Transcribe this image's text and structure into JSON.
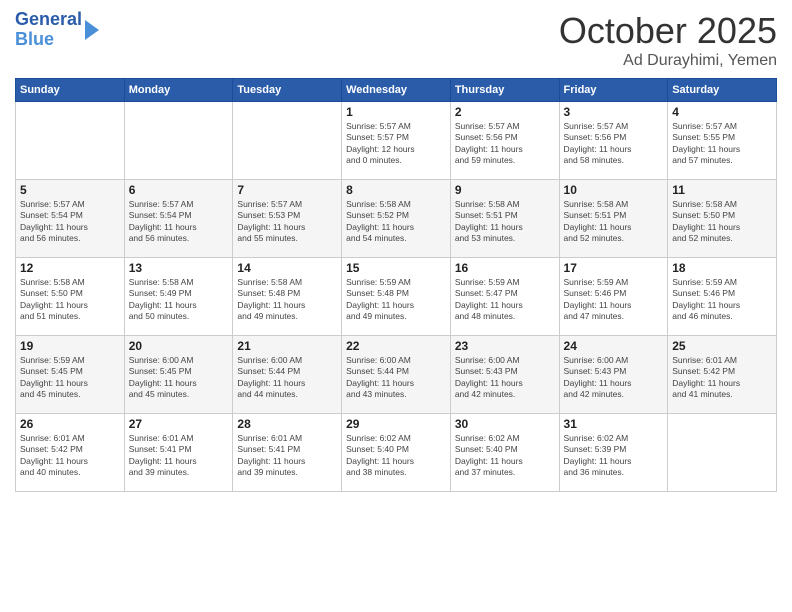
{
  "logo": {
    "line1": "General",
    "line2": "Blue"
  },
  "title": "October 2025",
  "location": "Ad Durayhimi, Yemen",
  "headers": [
    "Sunday",
    "Monday",
    "Tuesday",
    "Wednesday",
    "Thursday",
    "Friday",
    "Saturday"
  ],
  "weeks": [
    [
      {
        "day": "",
        "info": ""
      },
      {
        "day": "",
        "info": ""
      },
      {
        "day": "",
        "info": ""
      },
      {
        "day": "1",
        "info": "Sunrise: 5:57 AM\nSunset: 5:57 PM\nDaylight: 12 hours\nand 0 minutes."
      },
      {
        "day": "2",
        "info": "Sunrise: 5:57 AM\nSunset: 5:56 PM\nDaylight: 11 hours\nand 59 minutes."
      },
      {
        "day": "3",
        "info": "Sunrise: 5:57 AM\nSunset: 5:56 PM\nDaylight: 11 hours\nand 58 minutes."
      },
      {
        "day": "4",
        "info": "Sunrise: 5:57 AM\nSunset: 5:55 PM\nDaylight: 11 hours\nand 57 minutes."
      }
    ],
    [
      {
        "day": "5",
        "info": "Sunrise: 5:57 AM\nSunset: 5:54 PM\nDaylight: 11 hours\nand 56 minutes."
      },
      {
        "day": "6",
        "info": "Sunrise: 5:57 AM\nSunset: 5:54 PM\nDaylight: 11 hours\nand 56 minutes."
      },
      {
        "day": "7",
        "info": "Sunrise: 5:57 AM\nSunset: 5:53 PM\nDaylight: 11 hours\nand 55 minutes."
      },
      {
        "day": "8",
        "info": "Sunrise: 5:58 AM\nSunset: 5:52 PM\nDaylight: 11 hours\nand 54 minutes."
      },
      {
        "day": "9",
        "info": "Sunrise: 5:58 AM\nSunset: 5:51 PM\nDaylight: 11 hours\nand 53 minutes."
      },
      {
        "day": "10",
        "info": "Sunrise: 5:58 AM\nSunset: 5:51 PM\nDaylight: 11 hours\nand 52 minutes."
      },
      {
        "day": "11",
        "info": "Sunrise: 5:58 AM\nSunset: 5:50 PM\nDaylight: 11 hours\nand 52 minutes."
      }
    ],
    [
      {
        "day": "12",
        "info": "Sunrise: 5:58 AM\nSunset: 5:50 PM\nDaylight: 11 hours\nand 51 minutes."
      },
      {
        "day": "13",
        "info": "Sunrise: 5:58 AM\nSunset: 5:49 PM\nDaylight: 11 hours\nand 50 minutes."
      },
      {
        "day": "14",
        "info": "Sunrise: 5:58 AM\nSunset: 5:48 PM\nDaylight: 11 hours\nand 49 minutes."
      },
      {
        "day": "15",
        "info": "Sunrise: 5:59 AM\nSunset: 5:48 PM\nDaylight: 11 hours\nand 49 minutes."
      },
      {
        "day": "16",
        "info": "Sunrise: 5:59 AM\nSunset: 5:47 PM\nDaylight: 11 hours\nand 48 minutes."
      },
      {
        "day": "17",
        "info": "Sunrise: 5:59 AM\nSunset: 5:46 PM\nDaylight: 11 hours\nand 47 minutes."
      },
      {
        "day": "18",
        "info": "Sunrise: 5:59 AM\nSunset: 5:46 PM\nDaylight: 11 hours\nand 46 minutes."
      }
    ],
    [
      {
        "day": "19",
        "info": "Sunrise: 5:59 AM\nSunset: 5:45 PM\nDaylight: 11 hours\nand 45 minutes."
      },
      {
        "day": "20",
        "info": "Sunrise: 6:00 AM\nSunset: 5:45 PM\nDaylight: 11 hours\nand 45 minutes."
      },
      {
        "day": "21",
        "info": "Sunrise: 6:00 AM\nSunset: 5:44 PM\nDaylight: 11 hours\nand 44 minutes."
      },
      {
        "day": "22",
        "info": "Sunrise: 6:00 AM\nSunset: 5:44 PM\nDaylight: 11 hours\nand 43 minutes."
      },
      {
        "day": "23",
        "info": "Sunrise: 6:00 AM\nSunset: 5:43 PM\nDaylight: 11 hours\nand 42 minutes."
      },
      {
        "day": "24",
        "info": "Sunrise: 6:00 AM\nSunset: 5:43 PM\nDaylight: 11 hours\nand 42 minutes."
      },
      {
        "day": "25",
        "info": "Sunrise: 6:01 AM\nSunset: 5:42 PM\nDaylight: 11 hours\nand 41 minutes."
      }
    ],
    [
      {
        "day": "26",
        "info": "Sunrise: 6:01 AM\nSunset: 5:42 PM\nDaylight: 11 hours\nand 40 minutes."
      },
      {
        "day": "27",
        "info": "Sunrise: 6:01 AM\nSunset: 5:41 PM\nDaylight: 11 hours\nand 39 minutes."
      },
      {
        "day": "28",
        "info": "Sunrise: 6:01 AM\nSunset: 5:41 PM\nDaylight: 11 hours\nand 39 minutes."
      },
      {
        "day": "29",
        "info": "Sunrise: 6:02 AM\nSunset: 5:40 PM\nDaylight: 11 hours\nand 38 minutes."
      },
      {
        "day": "30",
        "info": "Sunrise: 6:02 AM\nSunset: 5:40 PM\nDaylight: 11 hours\nand 37 minutes."
      },
      {
        "day": "31",
        "info": "Sunrise: 6:02 AM\nSunset: 5:39 PM\nDaylight: 11 hours\nand 36 minutes."
      },
      {
        "day": "",
        "info": ""
      }
    ]
  ]
}
